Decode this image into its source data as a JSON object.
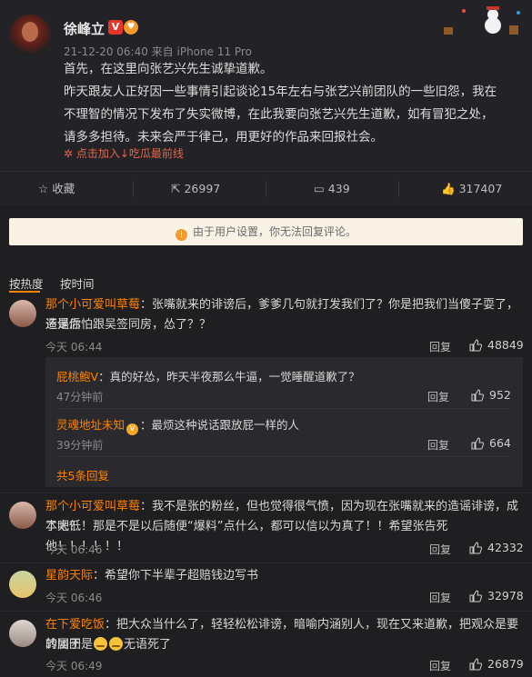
{
  "post": {
    "username": "徐峰立",
    "v_badge": "V",
    "meta": "21-12-20 06:40 来自 iPhone 11 Pro",
    "lines": [
      "首先，在这里向张艺兴先生诚挚道歉。",
      "昨天跟友人正好因一些事情引起谈论15年左右与张艺兴前团队的一些旧怨，我在",
      "不理智的情况下发布了失实微博，在此我要向张艺兴先生道歉，如有冒犯之处，",
      "请多多担待。未来会严于律己，用更好的作品来回报社会。"
    ],
    "source_link": "点击加入↓吃瓜最前线"
  },
  "actions": {
    "favorite": "收藏",
    "repost": "26997",
    "comments": "439",
    "likes": "317407"
  },
  "notice": "由于用户设置，你无法回复评论。",
  "sort": {
    "hot": "按热度",
    "time": "按时间"
  },
  "comments": [
    {
      "name": "那个小可爱叫草莓",
      "line1": "：张嘴就来的诽谤后，爹爹几句就打发我们了？你是把我们当傻子耍了，还是你",
      "line2": "造谣后怕跟吴签同房，怂了？？",
      "time": "今天 06:44",
      "reply": "回复",
      "likes": "48849"
    },
    {
      "name": "那个小可爱叫草莓",
      "line1": "：我不是张的粉丝，但也觉得很气愤，因为现在张嘴就来的造谣诽谤，成本太低",
      "line2": "了吧？！那是不是以后随便“爆料”点什么，都可以信以为真了！！希望张告死他！！！！！！",
      "time": "今天 06:46",
      "reply": "回复",
      "likes": "42332"
    },
    {
      "name": "星韵天际",
      "line1": "：希望你下半辈子超赔钱边写书",
      "time": "今天 06:46",
      "reply": "回复",
      "likes": "32978"
    },
    {
      "name": "在下爱吃饭",
      "line1": "：把大众当什么了，轻轻松松诽谤，暗喻内涵别人，现在又来道歉，把观众是要的团团",
      "line2a": "转属于是",
      "line2b": "无语死了",
      "time": "今天 06:49",
      "reply": "回复",
      "likes": "26879"
    }
  ],
  "subreplies": [
    {
      "name": "屁桃鲍V",
      "text": "：真的好怂，昨天半夜那么牛逼，一觉睡醒道歉了？",
      "time": "47分钟前",
      "reply": "回复",
      "likes": "952"
    },
    {
      "name": "灵魂地址未知",
      "text": "：最烦这种说话跟放屁一样的人",
      "time": "39分钟前",
      "reply": "回复",
      "likes": "664"
    }
  ],
  "more_replies": "共5条回复",
  "colors": {
    "accent": "#ff8200",
    "bg": "#1f1f22",
    "link": "#e8634a"
  }
}
